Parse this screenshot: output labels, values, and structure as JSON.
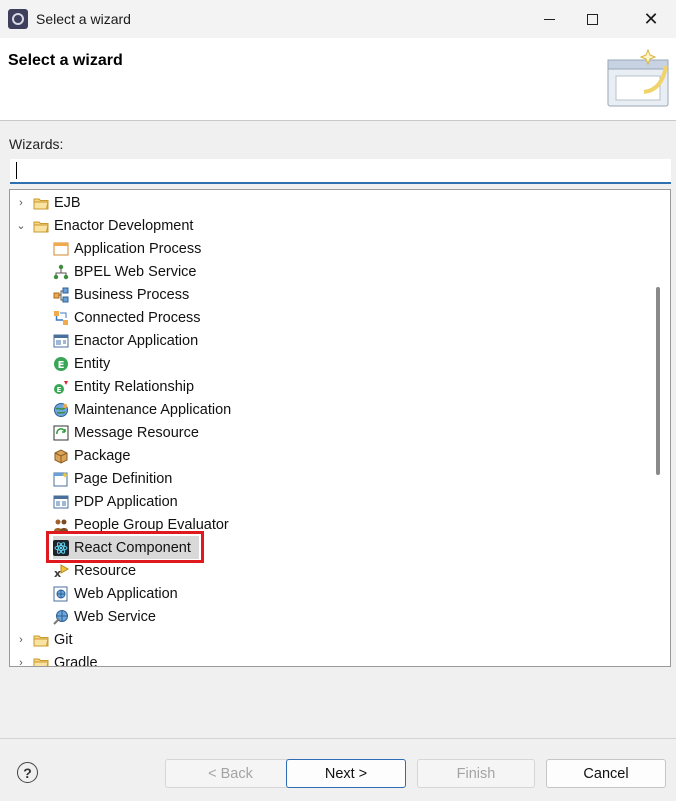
{
  "window": {
    "title": "Select a wizard"
  },
  "banner": {
    "title": "Select a wizard"
  },
  "wizards_label": "Wizards:",
  "filter": {
    "value": "",
    "placeholder": ""
  },
  "tree": {
    "folders": [
      {
        "label": "EJB",
        "expanded": false
      },
      {
        "label": "Enactor Development",
        "expanded": true
      },
      {
        "label": "Git",
        "expanded": false
      },
      {
        "label": "Gradle",
        "expanded": false
      }
    ],
    "children": [
      {
        "label": "Application Process",
        "icon": "application-process-icon"
      },
      {
        "label": "BPEL Web Service",
        "icon": "bpel-web-service-icon"
      },
      {
        "label": "Business Process",
        "icon": "business-process-icon"
      },
      {
        "label": "Connected Process",
        "icon": "connected-process-icon"
      },
      {
        "label": "Enactor Application",
        "icon": "enactor-application-icon"
      },
      {
        "label": "Entity",
        "icon": "entity-icon"
      },
      {
        "label": "Entity Relationship",
        "icon": "entity-relationship-icon"
      },
      {
        "label": "Maintenance Application",
        "icon": "maintenance-application-icon"
      },
      {
        "label": "Message Resource",
        "icon": "message-resource-icon"
      },
      {
        "label": "Package",
        "icon": "package-icon"
      },
      {
        "label": "Page Definition",
        "icon": "page-definition-icon"
      },
      {
        "label": "PDP Application",
        "icon": "pdp-application-icon"
      },
      {
        "label": "People Group Evaluator",
        "icon": "people-group-evaluator-icon"
      },
      {
        "label": "React Component",
        "icon": "react-component-icon",
        "selected": true
      },
      {
        "label": "Resource",
        "icon": "resource-icon"
      },
      {
        "label": "Web Application",
        "icon": "web-application-icon"
      },
      {
        "label": "Web Service",
        "icon": "web-service-icon"
      }
    ]
  },
  "buttons": {
    "back": "< Back",
    "next": "Next >",
    "finish": "Finish",
    "cancel": "Cancel"
  },
  "colors": {
    "highlight": "#e0191f",
    "focus_accent": "#2f6fb0",
    "folder": "#e8b64a"
  }
}
